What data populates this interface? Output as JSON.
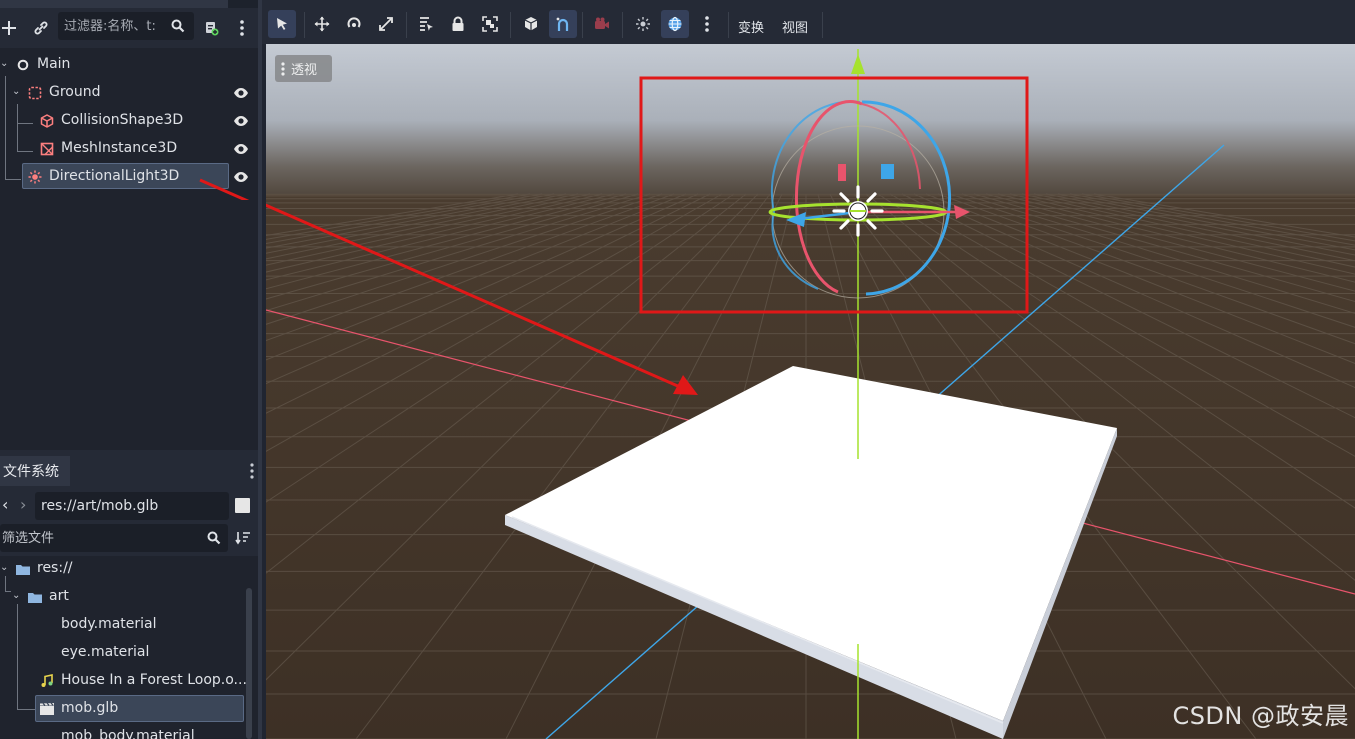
{
  "scene_dock": {
    "filter_placeholder": "过滤器:名称、t:",
    "nodes": [
      {
        "name": "Main",
        "type": "Node3D"
      },
      {
        "name": "Ground",
        "type": "StaticBody3D"
      },
      {
        "name": "CollisionShape3D",
        "type": "CollisionShape3D"
      },
      {
        "name": "MeshInstance3D",
        "type": "MeshInstance3D"
      },
      {
        "name": "DirectionalLight3D",
        "type": "DirectionalLight3D",
        "selected": true
      }
    ]
  },
  "filesystem_dock": {
    "tab": "文件系统",
    "path": "res://art/mob.glb",
    "filter_placeholder": "筛选文件",
    "items": [
      {
        "label": "res://",
        "kind": "folder"
      },
      {
        "label": "art",
        "kind": "folder"
      },
      {
        "label": "body.material",
        "kind": "material"
      },
      {
        "label": "eye.material",
        "kind": "material"
      },
      {
        "label": "House In a Forest Loop.o...",
        "kind": "audio"
      },
      {
        "label": "mob.glb",
        "kind": "scene",
        "selected": true
      },
      {
        "label": "mob_body.material",
        "kind": "material"
      }
    ]
  },
  "viewport": {
    "toolbar": {
      "transform_label": "变换",
      "view_label": "视图"
    },
    "perspective_label": "透视"
  },
  "colors": {
    "axis_x": "#e8546c",
    "axis_y": "#a6e22e",
    "axis_z": "#3ea6e8",
    "highlight_box": "#e01818",
    "ground_mesh": "#ffffff",
    "floor": "#3d3025"
  },
  "watermark": "CSDN @政安晨"
}
